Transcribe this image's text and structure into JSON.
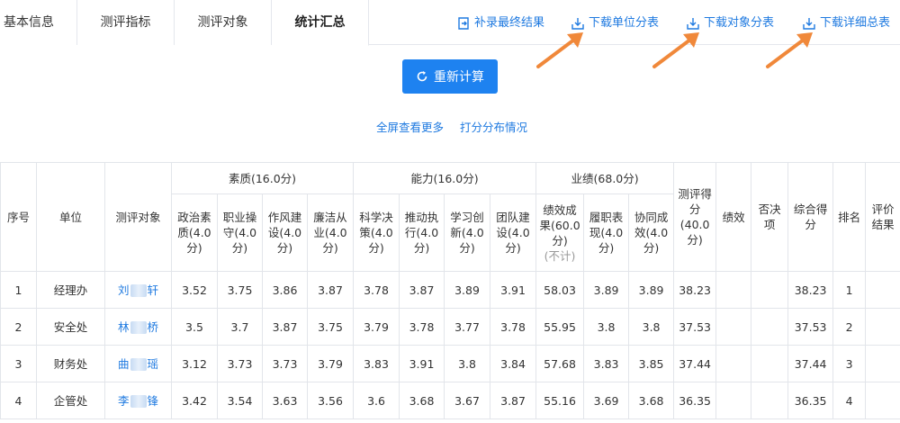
{
  "tabs": [
    {
      "label": "基本信息"
    },
    {
      "label": "测评指标"
    },
    {
      "label": "测评对象"
    },
    {
      "label": "统计汇总",
      "active": true
    }
  ],
  "actions": [
    {
      "label": "补录最终结果",
      "icon": "upload-icon"
    },
    {
      "label": "下载单位分表",
      "icon": "download-icon"
    },
    {
      "label": "下载对象分表",
      "icon": "download-icon"
    },
    {
      "label": "下载详细总表",
      "icon": "download-icon"
    }
  ],
  "recalc_label": "重新计算",
  "sublinks": [
    {
      "label": "全屏查看更多"
    },
    {
      "label": "打分分布情况"
    }
  ],
  "colors": {
    "primary": "#1e82f0",
    "link": "#1f7ae0",
    "annotation_arrow": "#f0883a",
    "border": "#e2e5ea"
  },
  "table": {
    "group_headers": {
      "quality": "素质(16.0分)",
      "ability": "能力(16.0分)",
      "performance": "业绩(68.0分)"
    },
    "headers": {
      "seq": "序号",
      "unit": "单位",
      "target": "测评对象",
      "q1": "政治素质(4.0分)",
      "q2": "职业操守(4.0分)",
      "q3": "作风建设(4.0分)",
      "q4": "廉洁从业(4.0分)",
      "a1": "科学决策(4.0分)",
      "a2": "推动执行(4.0分)",
      "a3": "学习创新(4.0分)",
      "a4": "团队建设(4.0分)",
      "p1": "绩效成果(60.0分)",
      "p1_note": "(不计)",
      "p2": "履职表现(4.0分)",
      "p3": "协同成效(4.0分)",
      "score": "测评得分(40.0分)",
      "perf": "绩效",
      "veto": "否决项",
      "total": "综合得分",
      "rank": "排名",
      "eval": "评价结果"
    },
    "rows": [
      {
        "seq": "1",
        "unit": "经理办",
        "name_first": "刘",
        "name_last": "轩",
        "q1": "3.52",
        "q2": "3.75",
        "q3": "3.86",
        "q4": "3.87",
        "a1": "3.78",
        "a2": "3.87",
        "a3": "3.89",
        "a4": "3.91",
        "p1": "58.03",
        "p2": "3.89",
        "p3": "3.89",
        "score": "38.23",
        "perf": "",
        "veto": "",
        "total": "38.23",
        "rank": "1",
        "eval": ""
      },
      {
        "seq": "2",
        "unit": "安全处",
        "name_first": "林",
        "name_last": "桥",
        "q1": "3.5",
        "q2": "3.7",
        "q3": "3.87",
        "q4": "3.75",
        "a1": "3.79",
        "a2": "3.78",
        "a3": "3.77",
        "a4": "3.78",
        "p1": "55.95",
        "p2": "3.8",
        "p3": "3.8",
        "score": "37.53",
        "perf": "",
        "veto": "",
        "total": "37.53",
        "rank": "2",
        "eval": ""
      },
      {
        "seq": "3",
        "unit": "财务处",
        "name_first": "曲",
        "name_last": "瑶",
        "q1": "3.12",
        "q2": "3.73",
        "q3": "3.73",
        "q4": "3.79",
        "a1": "3.83",
        "a2": "3.91",
        "a3": "3.8",
        "a4": "3.84",
        "p1": "57.68",
        "p2": "3.83",
        "p3": "3.85",
        "score": "37.44",
        "perf": "",
        "veto": "",
        "total": "37.44",
        "rank": "3",
        "eval": ""
      },
      {
        "seq": "4",
        "unit": "企管处",
        "name_first": "李",
        "name_last": "锋",
        "q1": "3.42",
        "q2": "3.54",
        "q3": "3.63",
        "q4": "3.56",
        "a1": "3.6",
        "a2": "3.68",
        "a3": "3.67",
        "a4": "3.87",
        "p1": "55.16",
        "p2": "3.69",
        "p3": "3.68",
        "score": "36.35",
        "perf": "",
        "veto": "",
        "total": "36.35",
        "rank": "4",
        "eval": ""
      }
    ]
  }
}
